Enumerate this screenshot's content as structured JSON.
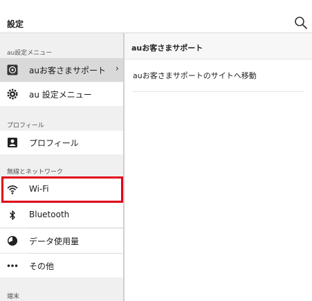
{
  "header": {
    "title": "設定"
  },
  "sidebar": {
    "sections": [
      {
        "label": "au設定メニュー"
      },
      {
        "label": "プロフィール"
      },
      {
        "label": "無線とネットワーク"
      },
      {
        "label": "端末"
      }
    ],
    "items": {
      "au_support": {
        "label": "auお客さまサポート",
        "icon": "au-support-icon"
      },
      "au_settings": {
        "label": "au 設定メニュー",
        "icon": "gear-icon"
      },
      "profile": {
        "label": "プロフィール",
        "icon": "contact-card-icon"
      },
      "wifi": {
        "label": "Wi-Fi",
        "icon": "wifi-icon"
      },
      "bluetooth": {
        "label": "Bluetooth",
        "icon": "bluetooth-icon"
      },
      "data_usage": {
        "label": "データ使用量",
        "icon": "data-usage-icon"
      },
      "more": {
        "label": "その他",
        "icon": "more-dots-icon"
      }
    }
  },
  "detail": {
    "title": "auお客さまサポート",
    "link": "auお客さまサポートのサイトへ移動"
  },
  "colors": {
    "highlight": "#e0001a",
    "sidebar_bg": "#f0f0f0",
    "selected_bg": "#d9d9d9"
  }
}
